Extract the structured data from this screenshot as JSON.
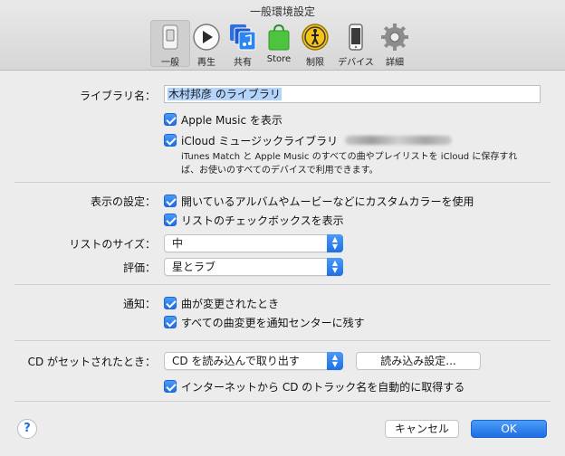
{
  "window": {
    "title": "一般環境設定"
  },
  "toolbar": {
    "items": [
      {
        "label": "一般",
        "icon": "general-switch-icon",
        "selected": true
      },
      {
        "label": "再生",
        "icon": "play-icon",
        "selected": false
      },
      {
        "label": "共有",
        "icon": "sharing-icon",
        "selected": false
      },
      {
        "label": "Store",
        "icon": "store-bag-icon",
        "selected": false
      },
      {
        "label": "制限",
        "icon": "parental-controls-icon",
        "selected": false
      },
      {
        "label": "デバイス",
        "icon": "device-phone-icon",
        "selected": false
      },
      {
        "label": "詳細",
        "icon": "gear-icon",
        "selected": false
      }
    ]
  },
  "library": {
    "label": "ライブラリ名：",
    "value": "木村邦彦 のライブラリ"
  },
  "apple_music": {
    "label": "Apple Music を表示",
    "checked": true
  },
  "icloud_music": {
    "label": "iCloud ミュージックライブラリ",
    "checked": true,
    "note_line1": "iTunes Match と Apple Music のすべての曲やプレイリストを iCloud に保存すれ",
    "note_line2": "ば、お使いのすべてのデバイスで利用できます。"
  },
  "view": {
    "label": "表示の設定：",
    "custom_colors": {
      "label": "開いているアルバムやムービーなどにカスタムカラーを使用",
      "checked": true
    },
    "list_checkboxes": {
      "label": "リストのチェックボックスを表示",
      "checked": true
    }
  },
  "list_size": {
    "label": "リストのサイズ：",
    "value": "中"
  },
  "rating": {
    "label": "評価：",
    "value": "星とラブ"
  },
  "notifications": {
    "label": "通知：",
    "song_changes": {
      "label": "曲が変更されたとき",
      "checked": true
    },
    "all_changes": {
      "label": "すべての曲変更を通知センターに残す",
      "checked": true
    }
  },
  "cd": {
    "label": "CD がセットされたとき：",
    "action": "CD を読み込んで取り出す",
    "import_settings": "読み込み設定...",
    "get_names": {
      "label": "インターネットから CD のトラック名を自動的に取得する",
      "checked": true
    }
  },
  "footer": {
    "help": "?",
    "cancel": "キャンセル",
    "ok": "OK"
  },
  "colors": {
    "accent": "#1f6fe5",
    "selection": "#b3d4fd"
  }
}
